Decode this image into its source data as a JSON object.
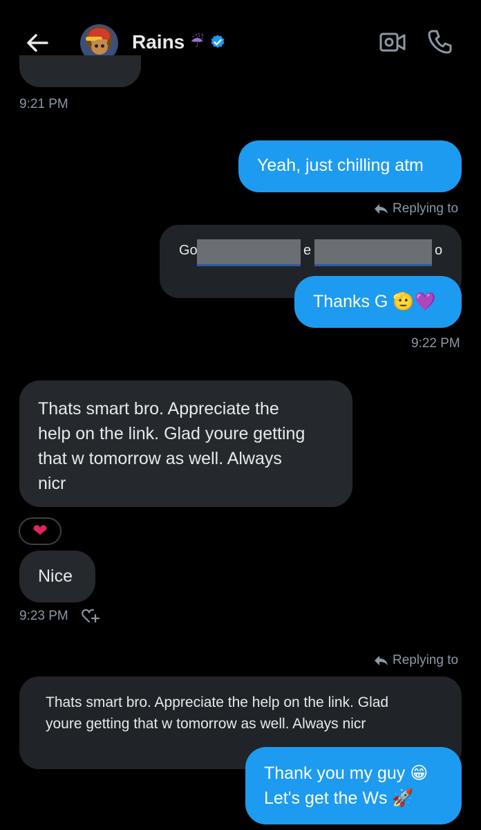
{
  "header": {
    "contact_name": "Rains",
    "name_emoji": "☔",
    "icons": [
      "back-arrow-icon",
      "avatar",
      "verified-badge-icon",
      "video-call-icon",
      "phone-call-icon"
    ],
    "verified_color": "#1d9bf0"
  },
  "messages": {
    "time_1": "9:21 PM",
    "out_1": "Yeah, just chilling atm",
    "replying_label": "Replying to",
    "quote_1_start": "Go",
    "quote_1_mid": "e",
    "quote_1_end": "o",
    "out_2": "Thanks G",
    "out_2_emoji": "🫡💜",
    "time_2": "9:22 PM",
    "in_1_lines": [
      "Thats smart bro. Appreciate the",
      "help on the link. Glad youre getting",
      "that w tomorrow as well. Always",
      "nicr"
    ],
    "reaction_emoji": "❤",
    "in_2": "Nice",
    "time_3": "9:23 PM",
    "replying_label_2": "Replying to",
    "quote_2_lines": [
      "Thats smart bro. Appreciate the help on the link. Glad",
      "youre getting that w tomorrow as well. Always nicr"
    ],
    "out_3_line_1": "Thank you my guy",
    "out_3_line_1_emoji": "😁",
    "out_3_line_2": "Let's get the Ws",
    "out_3_line_2_emoji": "🚀"
  },
  "colors": {
    "background": "#000000",
    "outgoing_bubble": "#1d9bf0",
    "incoming_bubble": "#25292e",
    "secondary_text": "#8b98a5"
  }
}
